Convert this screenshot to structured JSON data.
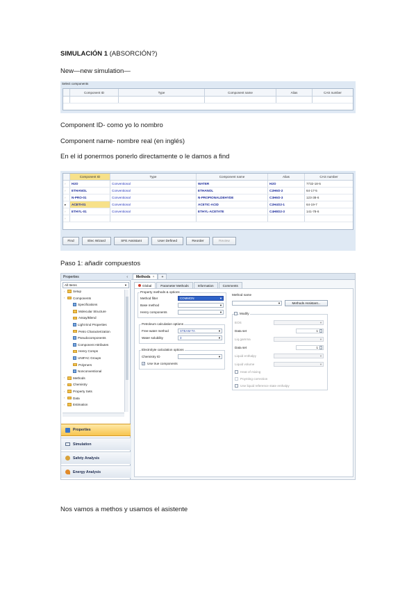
{
  "paragraphs": {
    "title_bold": "SIMULACIÓN 1",
    "title_rest": " (ABSORCIÓN?)",
    "p1": "New—new simulation—",
    "p2": "Component ID- como yo lo nombro",
    "p3": "Component name- nombre real (en inglés)",
    "p4": "En el id ponermos ponerlo directamente o le damos a find",
    "p5": "Paso 1: añadir compuestos",
    "p6": "Nos vamos a methos y usamos el asistente"
  },
  "fig1": {
    "caption": "Select components",
    "headers": [
      "Component ID",
      "Type",
      "Component name",
      "Alias",
      "CAS number"
    ]
  },
  "fig2": {
    "headers": [
      "Component ID",
      "Type",
      "Component name",
      "Alias",
      "CAS number"
    ],
    "rows": [
      {
        "id": "H2O",
        "type": "Conventional",
        "name": "WATER",
        "alias": "H2O",
        "cas": "7732-18-5"
      },
      {
        "id": "ETHANOL",
        "type": "Conventional",
        "name": "ETHANOL",
        "alias": "C2H6O-2",
        "cas": "64-17-5"
      },
      {
        "id": "N-PRO-01",
        "type": "Conventional",
        "name": "N-PROPIONALDEHYDE",
        "alias": "C3H6O-3",
        "cas": "123-38-6"
      },
      {
        "id": "ACETI-01",
        "type": "Conventional",
        "name": "ACETIC-ACID",
        "alias": "C2H4O2-1",
        "cas": "64-19-7"
      },
      {
        "id": "ETHYL-01",
        "type": "Conventional",
        "name": "ETHYL-ACETATE",
        "alias": "C4H8O2-3",
        "cas": "141-78-6"
      }
    ],
    "buttons": [
      "Find",
      "Elec Wizard",
      "SFE Assistant",
      "User Defined",
      "Reorder",
      "Review"
    ]
  },
  "fig3": {
    "nav_header": "Properties",
    "nav_select": "All Items",
    "tree": [
      {
        "label": "Setup",
        "indent": 1,
        "icon": "folder"
      },
      {
        "label": "Components",
        "indent": 1,
        "icon": "folder"
      },
      {
        "label": "Specifications",
        "indent": 2,
        "icon": "form"
      },
      {
        "label": "Molecular Structure",
        "indent": 2,
        "icon": "folder"
      },
      {
        "label": "Assay/Blend",
        "indent": 2,
        "icon": "folder"
      },
      {
        "label": "Light End Properties",
        "indent": 2,
        "icon": "form"
      },
      {
        "label": "Petro Characterization",
        "indent": 2,
        "icon": "folder"
      },
      {
        "label": "Pseudocomponents",
        "indent": 2,
        "icon": "form"
      },
      {
        "label": "Component Attributes",
        "indent": 2,
        "icon": "form"
      },
      {
        "label": "Henry Comps",
        "indent": 2,
        "icon": "folder"
      },
      {
        "label": "UNIFAC Groups",
        "indent": 2,
        "icon": "form"
      },
      {
        "label": "Polymers",
        "indent": 2,
        "icon": "folder"
      },
      {
        "label": "Nonconventional",
        "indent": 2,
        "icon": "form"
      },
      {
        "label": "Methods",
        "indent": 1,
        "icon": "folder"
      },
      {
        "label": "Chemistry",
        "indent": 1,
        "icon": "folder"
      },
      {
        "label": "Property Sets",
        "indent": 1,
        "icon": "folder"
      },
      {
        "label": "Data",
        "indent": 1,
        "icon": "folder"
      },
      {
        "label": "Estimation",
        "indent": 1,
        "icon": "folder"
      }
    ],
    "nav_buttons": [
      {
        "label": "Properties",
        "icon": "properties-icon",
        "active": true
      },
      {
        "label": "Simulation",
        "icon": "simulation-icon",
        "active": false
      },
      {
        "label": "Safety Analysis",
        "icon": "safety-icon",
        "active": false
      },
      {
        "label": "Energy Analysis",
        "icon": "energy-icon",
        "active": false
      }
    ],
    "doc_tab": "Methods",
    "doc_tab_close": "×",
    "doc_tab_add": "+",
    "subtabs": [
      "Global",
      "Parameter Methods",
      "Information",
      "Comments"
    ],
    "left": {
      "group1": "Property methods & options",
      "method_filter_label": "Method filter",
      "method_filter_value": "COMMON",
      "base_method_label": "Base method",
      "henry_label": "Henry components",
      "group2": "Petroleum calculation options",
      "free_water_label": "Free-water method",
      "free_water_value": "STEAM-TA",
      "water_sol_label": "Water solubility",
      "water_sol_value": "3",
      "group3": "Electrolyte calculation options",
      "chem_label": "Chemistry ID",
      "true_comp_label": "Use true components"
    },
    "right": {
      "method_name_label": "Method name",
      "wizard_button": "Methods Assistant...",
      "modify_label": "Modify",
      "eos_label": "EOS",
      "dataset1_label": "Data set",
      "dataset1_value": "1",
      "liq_gamma_label": "Liq gamma",
      "dataset2_label": "Data set",
      "dataset2_value": "1",
      "liq_enthalpy_label": "Liquid enthalpy",
      "liq_volume_label": "Liquid volume",
      "heat_mix_label": "Heat of mixing",
      "poynting_label": "Poynting correction",
      "interaction_label": "Use liquid reference state enthalpy"
    }
  },
  "colors": {
    "fig_bg": "#dfe9f4",
    "selection": "#f7e18a",
    "combo_highlight": "#2f63c8",
    "nav_active": "#f7c44f",
    "id_blue": "#1a2a9a"
  }
}
